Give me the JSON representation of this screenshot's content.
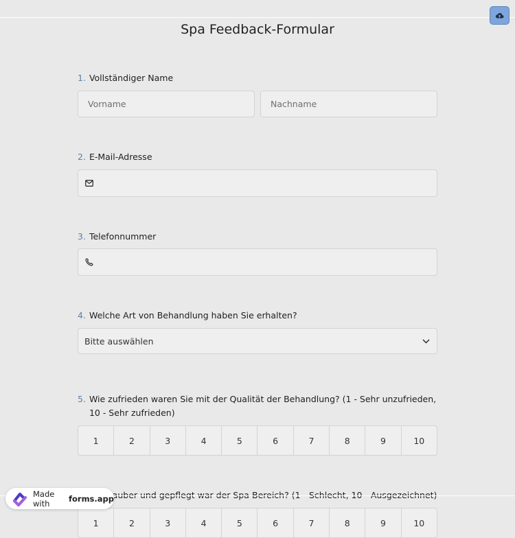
{
  "title": "Spa Feedback-Formular",
  "colors": {
    "accent": "#5d7fa6",
    "save_button": "#7ea6dc",
    "field_bg": "#efefef",
    "page_bg": "#e9e9e9"
  },
  "questions": [
    {
      "num": "1.",
      "label": "Vollständiger Name",
      "first_placeholder": "Vorname",
      "last_placeholder": "Nachname"
    },
    {
      "num": "2.",
      "label": "E-Mail-Adresse",
      "icon": "envelope-icon"
    },
    {
      "num": "3.",
      "label": "Telefonnummer",
      "icon": "phone-icon"
    },
    {
      "num": "4.",
      "label": "Welche Art von Behandlung haben Sie erhalten?",
      "selected": "Bitte auswählen"
    },
    {
      "num": "5.",
      "label": "Wie zufrieden waren Sie mit der Qualität der Behandlung? (1 - Sehr unzufrieden, 10 - Sehr zufrieden)",
      "scale": [
        "1",
        "2",
        "3",
        "4",
        "5",
        "6",
        "7",
        "8",
        "9",
        "10"
      ]
    },
    {
      "num": "6.",
      "label": "Wie sauber und gepflegt war der Spa-Bereich? (1 - Schlecht, 10 - Ausgezeichnet)"
    }
  ],
  "badge": {
    "prefix": "Made with",
    "brand": "forms.app"
  }
}
